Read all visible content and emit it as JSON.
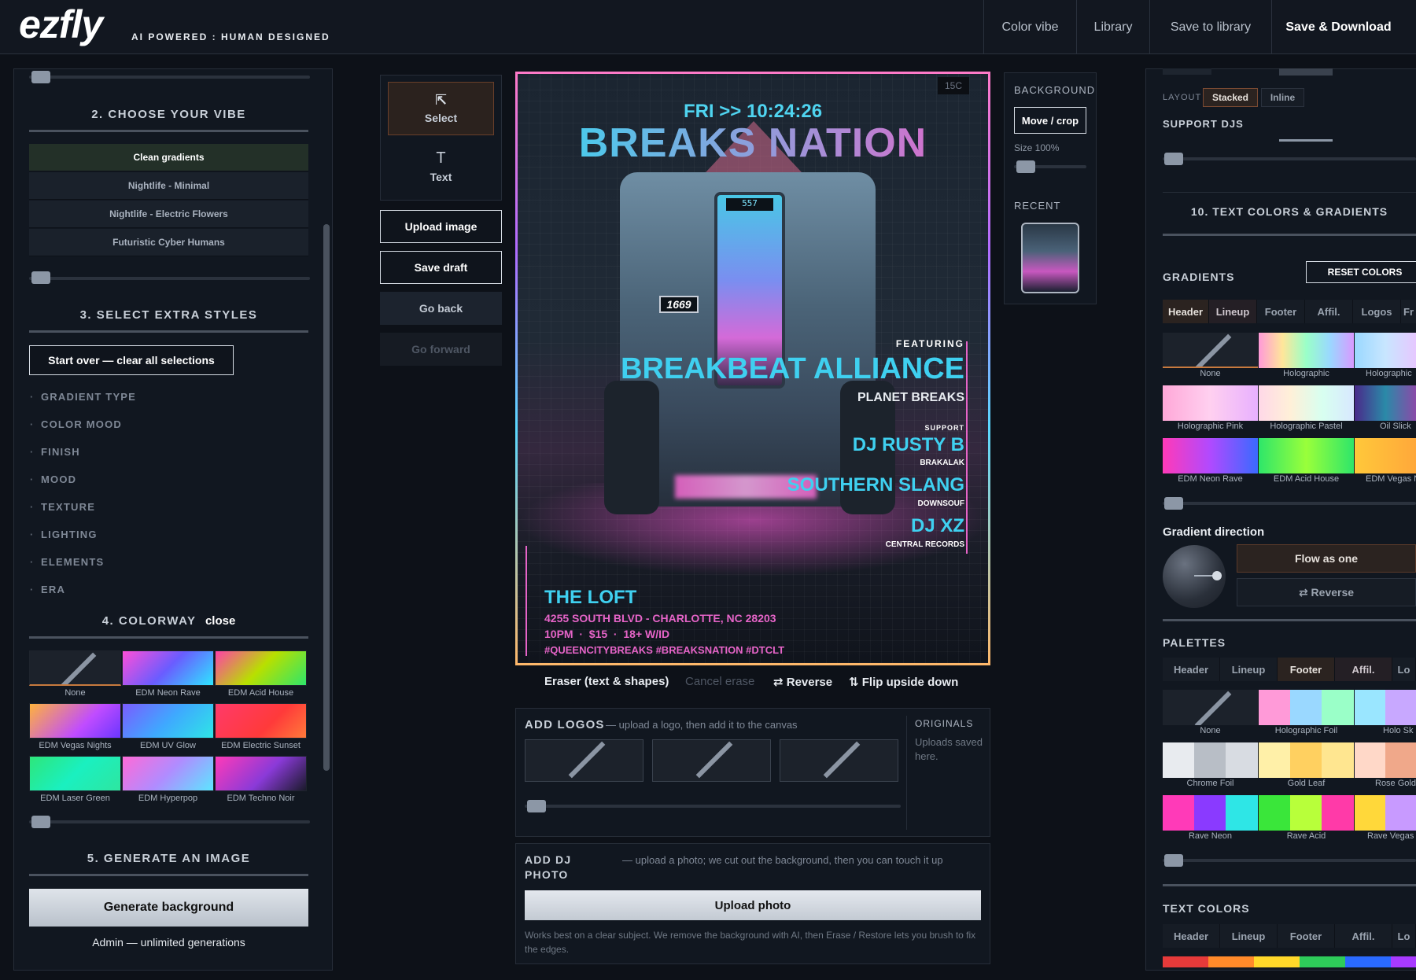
{
  "header": {
    "logo": "ezfly",
    "tagline": "AI POWERED : HUMAN DESIGNED",
    "nav": [
      "Color vibe",
      "Library",
      "Save to library",
      "Save & Download"
    ]
  },
  "left": {
    "vibe_title": "2. CHOOSE YOUR VIBE",
    "vibes": [
      "Clean gradients",
      "Nightlife - Minimal",
      "Nightlife - Electric Flowers",
      "Futuristic Cyber Humans"
    ],
    "extra_title": "3. SELECT EXTRA STYLES",
    "start_over": "Start over — clear all selections",
    "accordion": [
      "GRADIENT TYPE",
      "COLOR MOOD",
      "FINISH",
      "MOOD",
      "TEXTURE",
      "LIGHTING",
      "ELEMENTS",
      "ERA"
    ],
    "colorway_title": "4. COLORWAY",
    "colorway_close": "close",
    "colorways": [
      "None",
      "EDM Neon Rave",
      "EDM Acid House",
      "EDM Vegas Nights",
      "EDM UV Glow",
      "EDM Electric Sunset",
      "EDM Laser Green",
      "EDM Hyperpop",
      "EDM Techno Noir"
    ],
    "generate_title": "5. GENERATE AN IMAGE",
    "generate_button": "Generate background",
    "generate_note": "Admin — unlimited generations"
  },
  "tools": {
    "select": "Select",
    "text": "Text",
    "upload": "Upload image",
    "save_draft": "Save draft",
    "go_back": "Go back",
    "go_forward": "Go forward"
  },
  "poster": {
    "corner": "15C",
    "date": "FRI >> 10:24:26",
    "title": "BREAKS NATION",
    "truck_display": "557",
    "truck_plate": "1669",
    "featuring": "FEATURING",
    "headliner": "BREAKBEAT ALLIANCE",
    "headliner_sub": "PLANET BREAKS",
    "support": "SUPPORT",
    "djs": [
      {
        "name": "DJ RUSTY B",
        "label": "BRAKALAK"
      },
      {
        "name": "SOUTHERN SLANG",
        "label": "DOWNSOUF"
      },
      {
        "name": "DJ XZ",
        "label": "CENTRAL RECORDS"
      }
    ],
    "venue": "THE LOFT",
    "address": "4255 SOUTH BLVD - CHARLOTTE, NC 28203",
    "details": "10PM  ·  $15  ·  18+ W/ID",
    "hashtags": "#QUEENCITYBREAKS #BREAKSNATION #DTCLT"
  },
  "canvas_actions": {
    "eraser": "Eraser (text & shapes)",
    "cancel": "Cancel erase",
    "reverse": "⇄ Reverse",
    "flip": "⇅ Flip upside down"
  },
  "background_panel": {
    "title": "BACKGROUND",
    "move_crop": "Move / crop",
    "size": "Size 100%",
    "recent": "RECENT"
  },
  "logos": {
    "title": "ADD LOGOS",
    "hint": "— upload a logo, then add it to the canvas",
    "originals": "ORIGINALS",
    "originals_note": "Uploads saved here."
  },
  "dj_photo": {
    "title": "ADD DJ PHOTO",
    "hint": "— upload a photo; we cut out the background, then you can touch it up",
    "button": "Upload photo",
    "note": "Works best on a clear subject. We remove the background with AI, then Erase / Restore lets you brush to fix the edges."
  },
  "right": {
    "layout_label": "LAYOUT",
    "layout_options": [
      "Stacked",
      "Inline"
    ],
    "support_djs": "SUPPORT DJS",
    "text_colors_title": "10. TEXT COLORS & GRADIENTS",
    "gradients_label": "GRADIENTS",
    "reset_colors": "RESET COLORS",
    "tabs": [
      "Header",
      "Lineup",
      "Footer",
      "Affil.",
      "Logos",
      "Fr"
    ],
    "gradients": [
      "None",
      "Holographic",
      "Holographic",
      "Holographic Pink",
      "Holographic Pastel",
      "Oil Slick",
      "EDM Neon Rave",
      "EDM Acid House",
      "EDM Vegas N"
    ],
    "gradient_direction": "Gradient direction",
    "flow_as_one": "Flow as one",
    "reverse": "⇄ Reverse",
    "palettes_label": "PALETTES",
    "palette_tabs": [
      "Header",
      "Lineup",
      "Footer",
      "Affil.",
      "Lo"
    ],
    "palettes": [
      "None",
      "Holographic Foil",
      "Holo Sk",
      "Chrome Foil",
      "Gold Leaf",
      "Rose Gold",
      "Rave Neon",
      "Rave Acid",
      "Rave Vegas"
    ],
    "text_colors_label": "TEXT COLORS",
    "text_color_tabs": [
      "Header",
      "Lineup",
      "Footer",
      "Affil.",
      "Lo"
    ]
  },
  "colors": {
    "accent_cyan": "#3fd0f0",
    "accent_pink": "#e664c8",
    "panel_bg": "#111720"
  }
}
